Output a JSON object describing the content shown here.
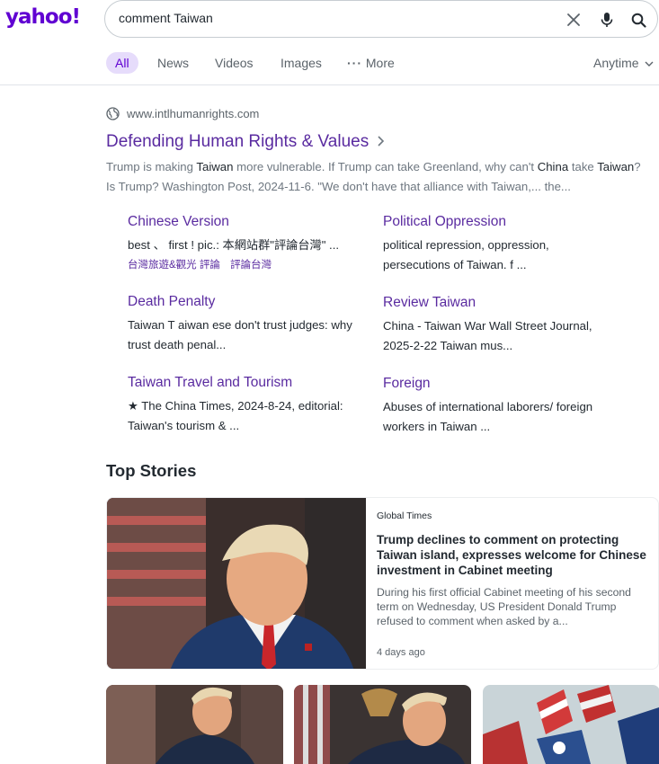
{
  "header": {
    "logo": "yahoo!",
    "search": {
      "value": "comment Taiwan",
      "placeholder": ""
    }
  },
  "tabs": [
    {
      "label": "All",
      "active": true
    },
    {
      "label": "News"
    },
    {
      "label": "Videos"
    },
    {
      "label": "Images"
    },
    {
      "label": "More"
    }
  ],
  "time_filter": "Anytime",
  "result": {
    "domain": "www.intlhumanrights.com",
    "title": "Defending Human Rights & Values",
    "snippet_parts": [
      {
        "text": "Trump is making ",
        "em": false
      },
      {
        "text": "Taiwan",
        "em": true
      },
      {
        "text": " more vulnerable. If Trump can take Greenland, why can't ",
        "em": false
      },
      {
        "text": "China",
        "em": true
      },
      {
        "text": " take ",
        "em": false
      },
      {
        "text": "Taiwan",
        "em": true
      },
      {
        "text": "? Is Trump? Washington Post, 2024-11-6. \"We don't have that alliance with Taiwan,... the...",
        "em": false
      }
    ],
    "sitelinks": [
      {
        "title": "Chinese Version",
        "desc": "best 、 first ! pic.: 本網站群\"評論台灣\" ...",
        "extra": [
          "台灣旅遊&觀光 評論",
          "評論台灣"
        ]
      },
      {
        "title": "Political Oppression",
        "desc": "political repression, oppression, persecutions of Taiwan. f ..."
      },
      {
        "title": "Death Penalty",
        "desc": "Taiwan T aiwan ese don't trust judges: why trust death penal..."
      },
      {
        "title": "Review Taiwan",
        "desc": "China - Taiwan War Wall Street Journal, 2025-2-22 Taiwan mus..."
      },
      {
        "title": "Taiwan Travel and Tourism",
        "desc": "★ The China Times, 2024-8-24, editorial: Taiwan's tourism & ..."
      },
      {
        "title": "Foreign",
        "desc": "Abuses of international laborers/ foreign workers in Taiwan ..."
      }
    ]
  },
  "top_stories": {
    "heading": "Top Stories",
    "main": {
      "source": "Global Times",
      "headline": "Trump declines to comment on protecting Taiwan island, expresses welcome for Chinese investment in Cabinet meeting",
      "summary": "During his first official Cabinet meeting of his second term on Wednesday, US President Donald Trump refused to comment when asked by a...",
      "time": "4 days ago"
    }
  },
  "colors": {
    "brand": "#6001d2",
    "link": "#5a2ba0",
    "active_tab_bg": "#e6dcfb",
    "text": "#232a31",
    "muted": "#6e7780"
  }
}
